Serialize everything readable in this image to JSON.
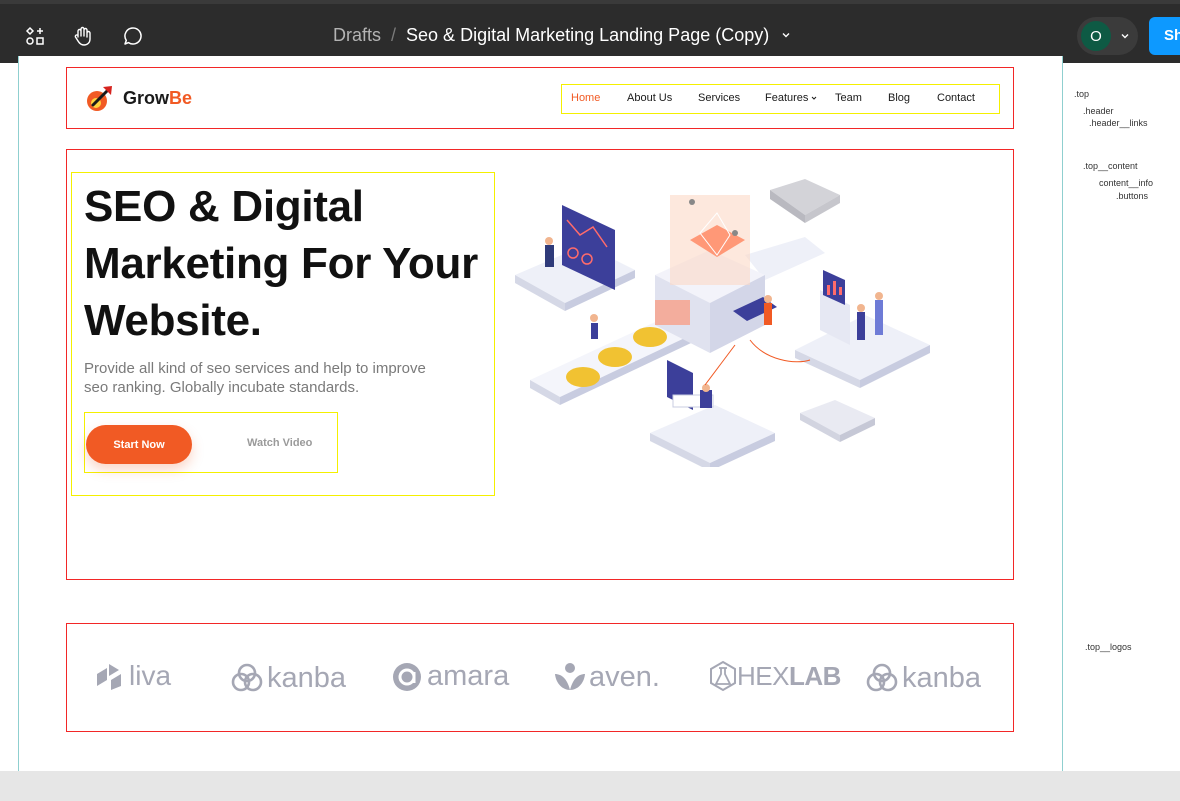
{
  "toolbar": {
    "icons": [
      "grid-shapes-icon",
      "hand-tool-icon",
      "comment-icon"
    ],
    "breadcrumb_root": "Drafts",
    "breadcrumb_separator": "/",
    "file_name": "Seo & Digital Marketing Landing Page (Copy)",
    "avatar_initial": "O",
    "share_label": "Sh",
    "share_color": "#0d99ff"
  },
  "site": {
    "brand_primary": "Grow",
    "brand_accent": "Be",
    "accent_color": "#f15a24",
    "nav": [
      {
        "label": "Home",
        "active": true
      },
      {
        "label": "About Us"
      },
      {
        "label": "Services"
      },
      {
        "label": "Features"
      },
      {
        "label": "Team"
      },
      {
        "label": "Blog"
      },
      {
        "label": "Contact"
      }
    ],
    "hero": {
      "title_line1": "SEO & Digital",
      "title_line2": "Marketing For Your",
      "title_line3": "Website.",
      "desc_line1": "Provide all kind of seo services and help to improve",
      "desc_line2": "seo ranking. Globally incubate standards.",
      "primary_button": "Start Now",
      "secondary_button": "Watch Video"
    },
    "partner_logos": [
      "liva",
      "kanba",
      "amara",
      "aven.",
      "HEX",
      "LAB",
      "kanba"
    ]
  },
  "layer_notes": {
    "top": ".top",
    "header": ".header",
    "header_links": ".header__links",
    "top_content": ".top__content",
    "content_info": "content__info",
    "buttons": ".buttons",
    "top_logos": ".top__logos"
  },
  "annotation_colors": {
    "section": "#f22727",
    "group": "#f4f000",
    "frame": "#8fcfcf"
  }
}
